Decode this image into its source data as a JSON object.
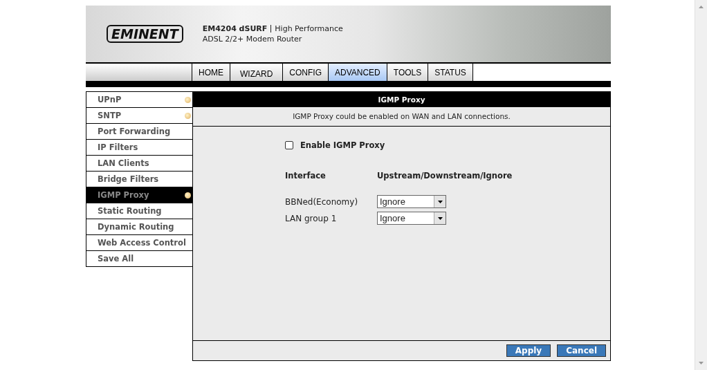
{
  "header": {
    "logo": "EMINENT",
    "model": "EM4204 dSURF",
    "tagline": "High Performance",
    "subtitle": "ADSL 2/2+ Modem Router"
  },
  "tabs": [
    {
      "label": "HOME",
      "selected": false
    },
    {
      "label": "WIZARD",
      "selected": false
    },
    {
      "label": "CONFIG",
      "selected": false
    },
    {
      "label": "ADVANCED",
      "selected": true
    },
    {
      "label": "TOOLS",
      "selected": false
    },
    {
      "label": "STATUS",
      "selected": false
    }
  ],
  "sidebar": {
    "items": [
      {
        "label": "UPnP",
        "selected": false,
        "bullet": true
      },
      {
        "label": "SNTP",
        "selected": false,
        "bullet": true
      },
      {
        "label": "Port Forwarding",
        "selected": false,
        "bullet": false
      },
      {
        "label": "IP Filters",
        "selected": false,
        "bullet": false
      },
      {
        "label": "LAN Clients",
        "selected": false,
        "bullet": false
      },
      {
        "label": "Bridge Filters",
        "selected": false,
        "bullet": false
      },
      {
        "label": "IGMP Proxy",
        "selected": true,
        "bullet": true
      },
      {
        "label": "Static Routing",
        "selected": false,
        "bullet": false
      },
      {
        "label": "Dynamic Routing",
        "selected": false,
        "bullet": false
      },
      {
        "label": "Web Access Control",
        "selected": false,
        "bullet": false
      },
      {
        "label": "Save All",
        "selected": false,
        "bullet": false
      }
    ]
  },
  "panel": {
    "title": "IGMP Proxy",
    "description": "IGMP Proxy could be enabled on WAN and LAN connections.",
    "enable": {
      "label": "Enable IGMP Proxy",
      "checked": false
    },
    "columns": [
      "Interface",
      "Upstream/Downstream/Ignore"
    ],
    "rows": [
      {
        "interface": "BBNed(Economy)",
        "mode": "Ignore"
      },
      {
        "interface": "LAN group 1",
        "mode": "Ignore"
      }
    ],
    "buttons": [
      "Apply",
      "Cancel"
    ]
  }
}
